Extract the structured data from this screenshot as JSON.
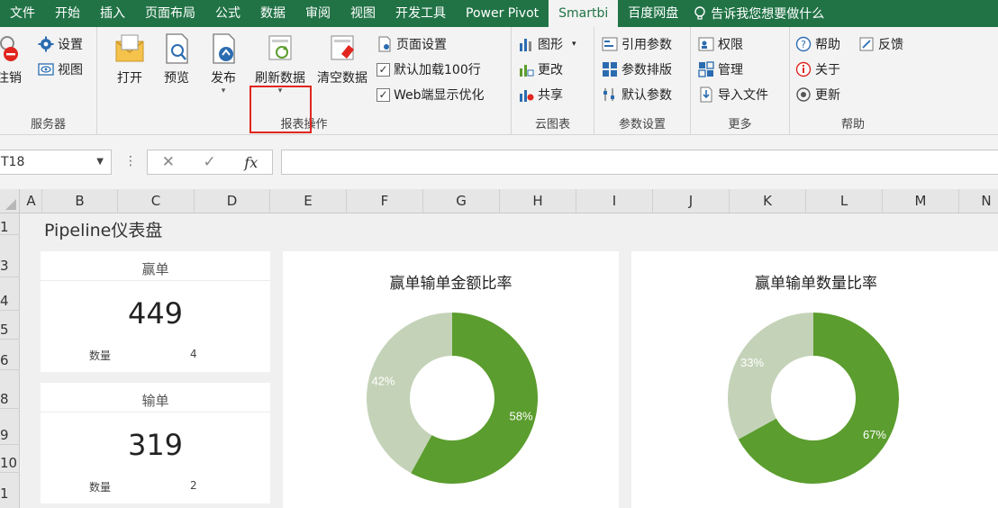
{
  "ribbon_tabs": [
    "文件",
    "开始",
    "插入",
    "页面布局",
    "公式",
    "数据",
    "审阅",
    "视图",
    "开发工具",
    "Power Pivot",
    "Smartbi",
    "百度网盘"
  ],
  "active_tab": "Smartbi",
  "tell_me": "告诉我您想要做什么",
  "ribbon": {
    "server": {
      "label": "服务器",
      "logout": "注销",
      "settings": "设置",
      "view": "视图"
    },
    "report_ops": {
      "label": "报表操作",
      "open": "打开",
      "preview": "预览",
      "publish": "发布",
      "refresh": "刷新数据",
      "clear": "清空数据",
      "page_setup": "页面设置",
      "default_load": "默认加载100行",
      "web_optimize": "Web端显示优化"
    },
    "cloud_chart": {
      "label": "云图表",
      "chart": "图形",
      "change": "更改",
      "share": "共享"
    },
    "param_settings": {
      "label": "参数设置",
      "ref_param": "引用参数",
      "param_layout": "参数排版",
      "default_param": "默认参数"
    },
    "more": {
      "label": "更多",
      "permission": "权限",
      "manage": "管理",
      "import_file": "导入文件"
    },
    "help": {
      "label": "帮助",
      "help": "帮助",
      "feedback": "反馈",
      "about": "关于",
      "update": "更新"
    }
  },
  "formula_bar": {
    "name_box": "T18",
    "cancel": "✕",
    "confirm": "✓",
    "fx": "fx",
    "formula": ""
  },
  "columns": [
    "A",
    "B",
    "C",
    "D",
    "E",
    "F",
    "G",
    "H",
    "I",
    "J",
    "K",
    "L",
    "M",
    "N"
  ],
  "rows": [
    "1",
    "3",
    "4",
    "5",
    "6",
    "8",
    "9",
    "10",
    "1"
  ],
  "dashboard": {
    "title": "Pipeline仪表盘",
    "win_card": {
      "label": "赢单",
      "value": "449",
      "count_label": "数量",
      "count": "4"
    },
    "loss_card": {
      "label": "输单",
      "value": "319",
      "count_label": "数量",
      "count": "2"
    }
  },
  "chart_data": [
    {
      "type": "pie",
      "title": "赢单输单金额比率",
      "categories": [
        "赢单",
        "输单"
      ],
      "values": [
        58,
        42
      ],
      "labels": [
        "58%",
        "42%"
      ],
      "colors": [
        "#5b9d2e",
        "#c4d3b8"
      ]
    },
    {
      "type": "pie",
      "title": "赢单输单数量比率",
      "categories": [
        "赢单",
        "输单"
      ],
      "values": [
        67,
        33
      ],
      "labels": [
        "67%",
        "33%"
      ],
      "colors": [
        "#5b9d2e",
        "#c4d3b8"
      ]
    }
  ]
}
